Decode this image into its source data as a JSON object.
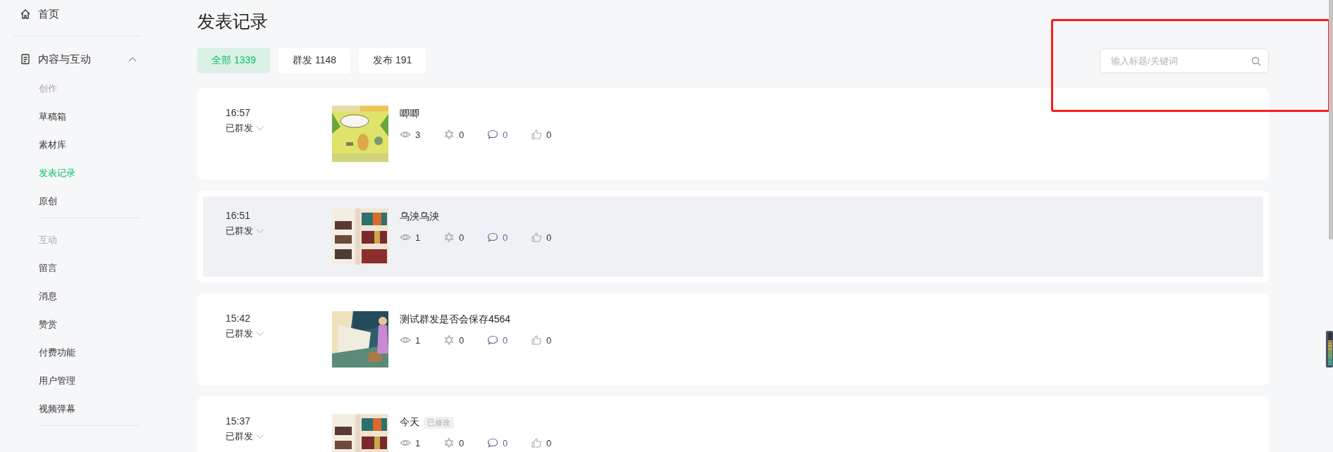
{
  "sidebar": {
    "home": {
      "label": "首页"
    },
    "section": {
      "label": "内容与互动",
      "expanded": true,
      "groups": [
        {
          "heading": "创作",
          "items": [
            {
              "label": "草稿箱",
              "selected": false
            },
            {
              "label": "素材库",
              "selected": false
            },
            {
              "label": "发表记录",
              "selected": true
            },
            {
              "label": "原创",
              "selected": false
            }
          ]
        },
        {
          "heading": "互动",
          "items": [
            {
              "label": "留言",
              "selected": false
            },
            {
              "label": "消息",
              "selected": false
            },
            {
              "label": "赞赏",
              "selected": false
            },
            {
              "label": "付费功能",
              "selected": false
            },
            {
              "label": "用户管理",
              "selected": false
            },
            {
              "label": "视频弹幕",
              "selected": false
            }
          ]
        }
      ]
    }
  },
  "page_title": "发表记录",
  "tabs": [
    {
      "label": "全部 1339",
      "selected": true
    },
    {
      "label": "群发 1148",
      "selected": false
    },
    {
      "label": "发布 191",
      "selected": false
    }
  ],
  "search": {
    "placeholder": "输入标题/关键词"
  },
  "posts": [
    {
      "time": "16:57",
      "status": "已群发",
      "title": "唧唧",
      "highlighted": false,
      "views": "3",
      "shares": "0",
      "comments": "0",
      "likes": "0"
    },
    {
      "time": "16:51",
      "status": "已群发",
      "title": "乌泱乌泱",
      "highlighted": true,
      "views": "1",
      "shares": "0",
      "comments": "0",
      "likes": "0"
    },
    {
      "time": "15:42",
      "status": "已群发",
      "title": "测试群发是否会保存4564",
      "highlighted": false,
      "views": "1",
      "shares": "0",
      "comments": "0",
      "likes": "0"
    },
    {
      "time": "15:37",
      "status": "已群发",
      "title": "今天",
      "badge": "已修改",
      "highlighted": false,
      "views": "1",
      "shares": "0",
      "comments": "0",
      "likes": "0"
    }
  ]
}
